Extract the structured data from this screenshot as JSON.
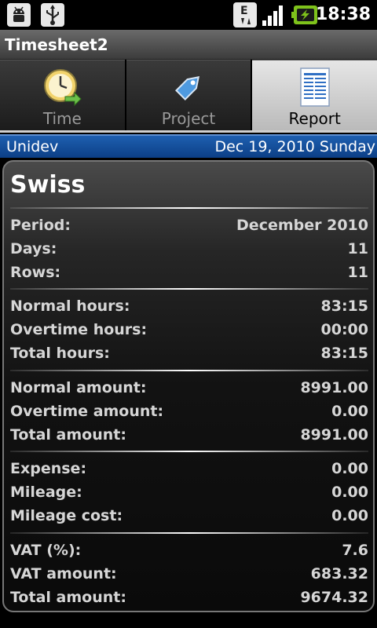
{
  "status_bar": {
    "time": "18:38",
    "icons": [
      "android-debug-icon",
      "usb-icon",
      "edge-data-icon",
      "signal-icon",
      "battery-charging-icon"
    ]
  },
  "app_title": "Timesheet2",
  "tabs": [
    {
      "label": "Time",
      "icon": "clock-icon",
      "selected": false
    },
    {
      "label": "Project",
      "icon": "tag-icon",
      "selected": false
    },
    {
      "label": "Report",
      "icon": "document-icon",
      "selected": true
    }
  ],
  "info": {
    "company": "Unidev",
    "date": "Dec 19, 2010 Sunday"
  },
  "report": {
    "title": "Swiss",
    "groups": [
      [
        {
          "label": "Period:",
          "value": "December 2010"
        },
        {
          "label": "Days:",
          "value": "11"
        },
        {
          "label": "Rows:",
          "value": "11"
        }
      ],
      [
        {
          "label": "Normal hours:",
          "value": "83:15"
        },
        {
          "label": "Overtime hours:",
          "value": "00:00"
        },
        {
          "label": "Total hours:",
          "value": "83:15"
        }
      ],
      [
        {
          "label": "Normal amount:",
          "value": "8991.00"
        },
        {
          "label": "Overtime amount:",
          "value": "0.00"
        },
        {
          "label": "Total amount:",
          "value": "8991.00"
        }
      ],
      [
        {
          "label": "Expense:",
          "value": "0.00"
        },
        {
          "label": "Mileage:",
          "value": "0.00"
        },
        {
          "label": "Mileage cost:",
          "value": "0.00"
        }
      ],
      [
        {
          "label": "VAT (%):",
          "value": "7.6"
        },
        {
          "label": "VAT amount:",
          "value": "683.32"
        },
        {
          "label": "Total amount:",
          "value": "9674.32"
        }
      ]
    ]
  },
  "colors": {
    "accent_blue": "#0c3f86",
    "status_green": "#7ec21b"
  }
}
